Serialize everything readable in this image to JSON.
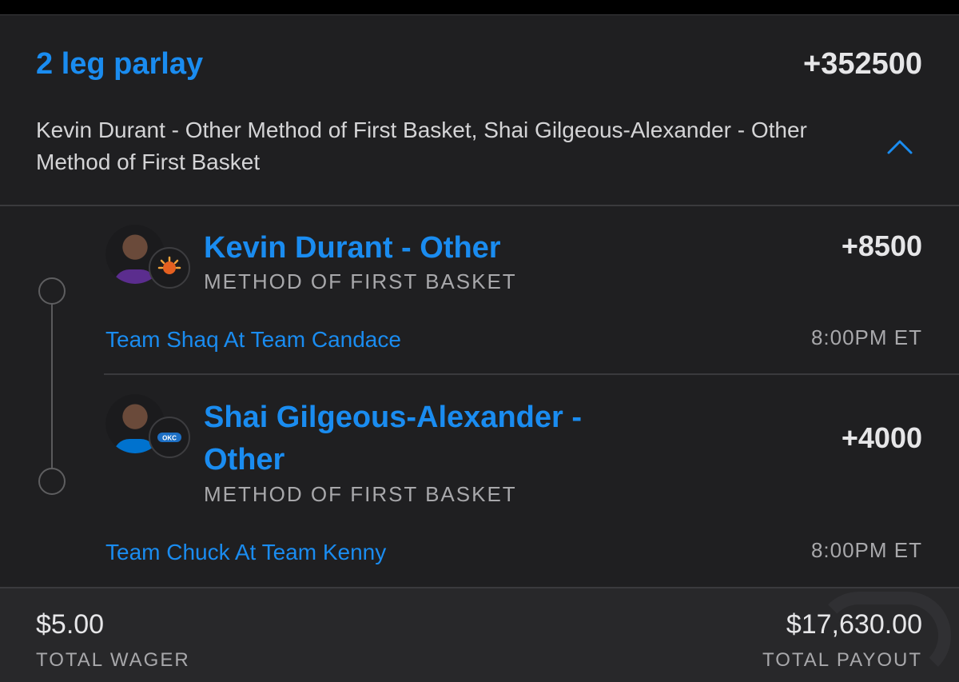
{
  "parlay": {
    "title": "2 leg parlay",
    "odds": "+352500",
    "description": "Kevin Durant - Other Method of First Basket, Shai Gilgeous-Alexander - Other Method of First Basket",
    "expand_icon": "chevron-up-icon"
  },
  "legs": [
    {
      "player": "Kevin Durant - Other",
      "market": "METHOD OF FIRST BASKET",
      "odds": "+8500",
      "matchup": "Team Shaq At Team Candace",
      "time": "8:00PM ET",
      "team_icon": "suns-logo-icon",
      "jersey_color": "#5b2d8e"
    },
    {
      "player_line1": "Shai Gilgeous-Alexander -",
      "player_line2": "Other",
      "market": "METHOD OF FIRST BASKET",
      "odds": "+4000",
      "matchup": "Team Chuck At Team Kenny",
      "time": "8:00PM ET",
      "team_icon": "thunder-logo-icon",
      "jersey_color": "#0072ce"
    }
  ],
  "footer": {
    "wager_amount": "$5.00",
    "wager_label": "TOTAL WAGER",
    "payout_amount": "$17,630.00",
    "payout_label": "TOTAL PAYOUT"
  },
  "colors": {
    "accent": "#1a8cf0",
    "background": "#1f1f21",
    "text_primary": "#e6e6e8",
    "text_secondary": "#a8a8ab"
  }
}
